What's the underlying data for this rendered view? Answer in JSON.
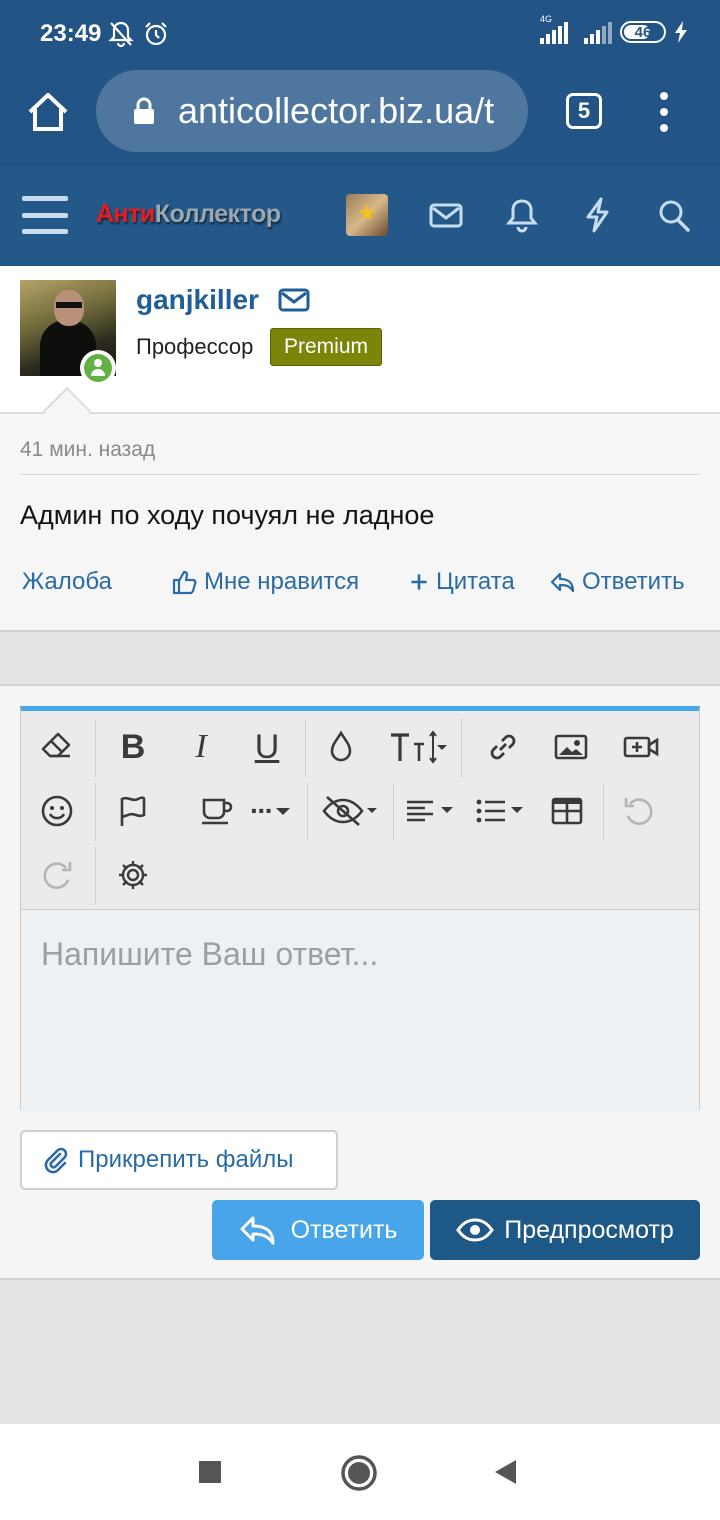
{
  "status_bar": {
    "time": "23:49",
    "network_label": "4G",
    "battery": "46"
  },
  "browser": {
    "url": "anticollector.biz.ua/t",
    "tab_count": "5"
  },
  "site": {
    "logo_red": "Анти",
    "logo_grey": "Коллектор"
  },
  "post": {
    "username": "ganjkiller",
    "user_title": "Профессор",
    "badge": "Premium",
    "time": "41 мин. назад",
    "message": "Админ по ходу почуял не ладное",
    "actions": {
      "report": "Жалоба",
      "like": "Мне нравится",
      "quote": "Цитата",
      "reply": "Ответить"
    }
  },
  "editor": {
    "placeholder": "Напишите Ваш ответ...",
    "toolbar": {
      "bold": "B",
      "italic": "I",
      "underline": "U",
      "more": "···"
    }
  },
  "buttons": {
    "attach": "Прикрепить файлы",
    "reply": "Ответить",
    "preview": "Предпросмотр"
  },
  "colors": {
    "header": "#225585",
    "link": "#2a6aa6",
    "accent": "#47a7eb",
    "premium": "#7b850a",
    "online": "#63b044"
  }
}
